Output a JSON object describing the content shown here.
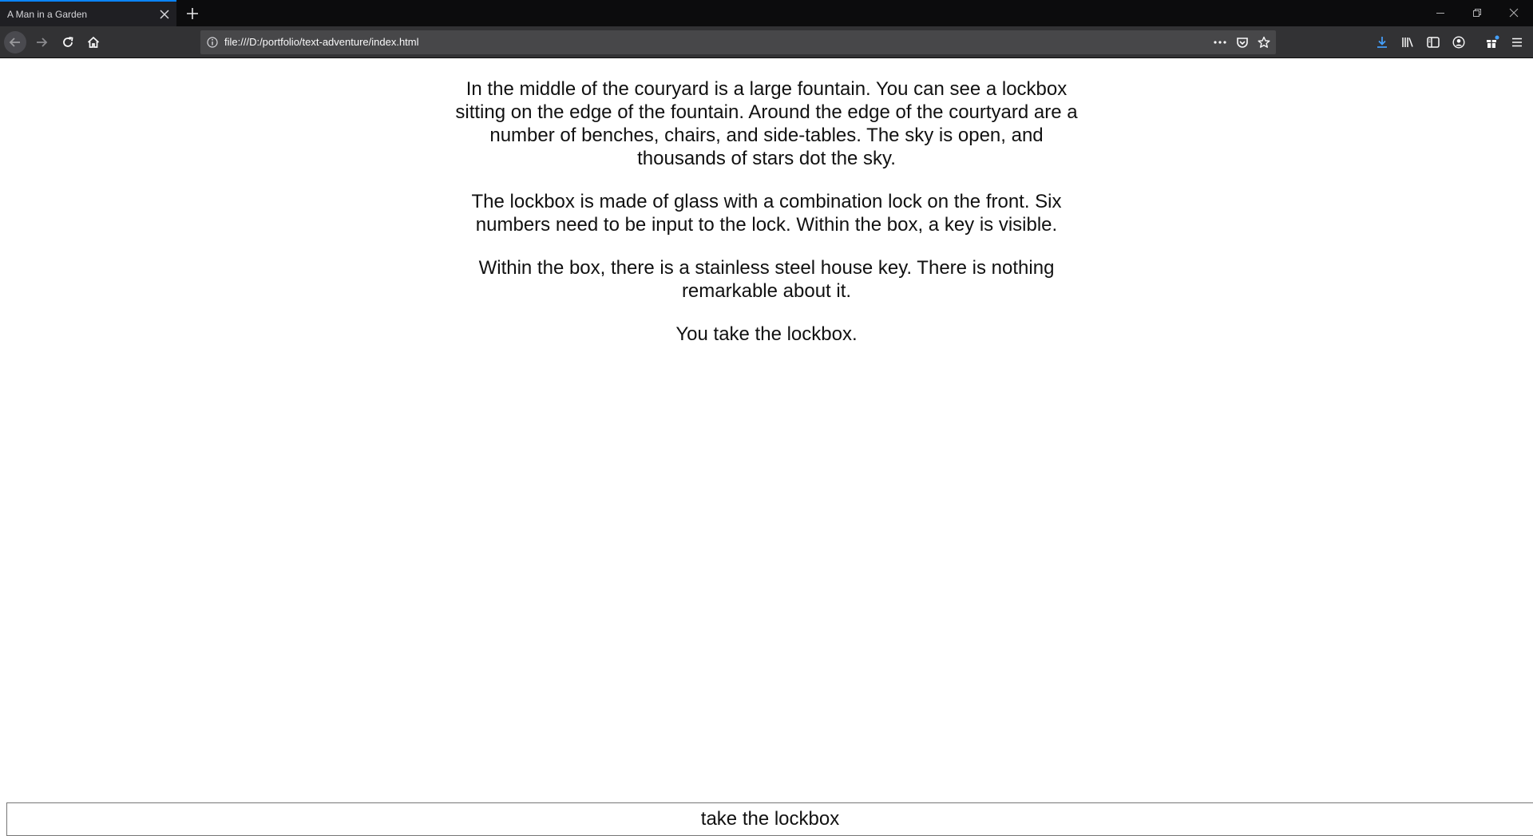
{
  "browser": {
    "tab_title": "A Man in a Garden",
    "url": "file:///D:/portfolio/text-adventure/index.html",
    "accent_color": "#0a84ff"
  },
  "icons": {
    "tab_close": "close-icon",
    "new_tab": "plus-icon",
    "back": "arrow-left-icon",
    "forward": "arrow-right-icon",
    "reload": "reload-icon",
    "home": "home-icon",
    "site_info": "info-icon",
    "page_actions": "more-icon",
    "pocket": "pocket-icon",
    "bookmark": "star-icon",
    "downloads": "download-icon",
    "library": "library-icon",
    "sidebar": "sidebar-icon",
    "account": "account-icon",
    "whats_new": "gift-icon",
    "menu": "hamburger-icon",
    "minimize": "minimize-icon",
    "restore": "restore-icon",
    "close_window": "close-icon"
  },
  "story": {
    "paragraphs": [
      "In the middle of the couryard is a large fountain. You can see a lockbox sitting on the edge of the fountain. Around the edge of the courtyard are a number of benches, chairs, and side-tables. The sky is open, and thousands of stars dot the sky.",
      "The lockbox is made of glass with a combination lock on the front. Six numbers need to be input to the lock. Within the box, a key is visible.",
      "Within the box, there is a stainless steel house key. There is nothing remarkable about it.",
      "You take the lockbox."
    ]
  },
  "command": {
    "value": "take the lockbox"
  }
}
